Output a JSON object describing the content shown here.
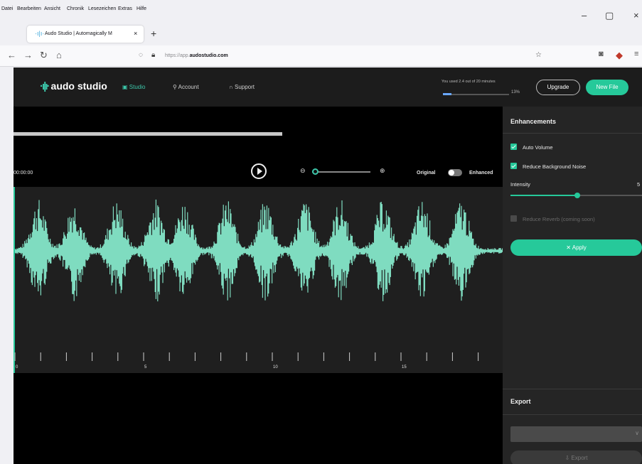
{
  "browser": {
    "menu": [
      "Datei",
      "Bearbeiten",
      "Ansicht",
      "Chronik",
      "Lesezeichen",
      "Extras",
      "Hilfe"
    ],
    "tab_title": "Audo Studio | Automagically M",
    "tab_close": "×",
    "new_tab": "+",
    "url_prefix": "https://app.",
    "url_domain": "audostudio.com",
    "window_minimize": "–",
    "window_maximize": "▢",
    "window_close": "×"
  },
  "app": {
    "brand": "audo studio",
    "nav": {
      "studio": "Studio",
      "account": "Account",
      "support": "Support"
    },
    "usage": {
      "text": "You used 2.4 out of 20 minutes",
      "percent_label": "13%",
      "percent": 13
    },
    "upgrade_label": "Upgrade",
    "new_file_label": "New File"
  },
  "player": {
    "time": "00:00:00",
    "playback_progress": 0.54,
    "zoom_level": 0,
    "original_label": "Original",
    "enhanced_label": "Enhanced",
    "timeline_labels": [
      "0",
      "5",
      "10",
      "15"
    ]
  },
  "enhancements": {
    "title": "Enhancements",
    "auto_volume": {
      "label": "Auto Volume",
      "checked": true
    },
    "reduce_noise": {
      "label": "Reduce Background Noise",
      "checked": true
    },
    "intensity_label": "Intensity",
    "intensity_value": "5",
    "intensity_fraction": 0.5,
    "reduce_reverb": {
      "label": "Reduce Reverb (coming soon)",
      "checked": false
    },
    "apply_label": "Apply"
  },
  "export": {
    "title": "Export",
    "button_label": "Export"
  },
  "colors": {
    "accent": "#26c99a",
    "waveform": "#7fdcc0",
    "background": "#000000",
    "panel": "#252525"
  }
}
